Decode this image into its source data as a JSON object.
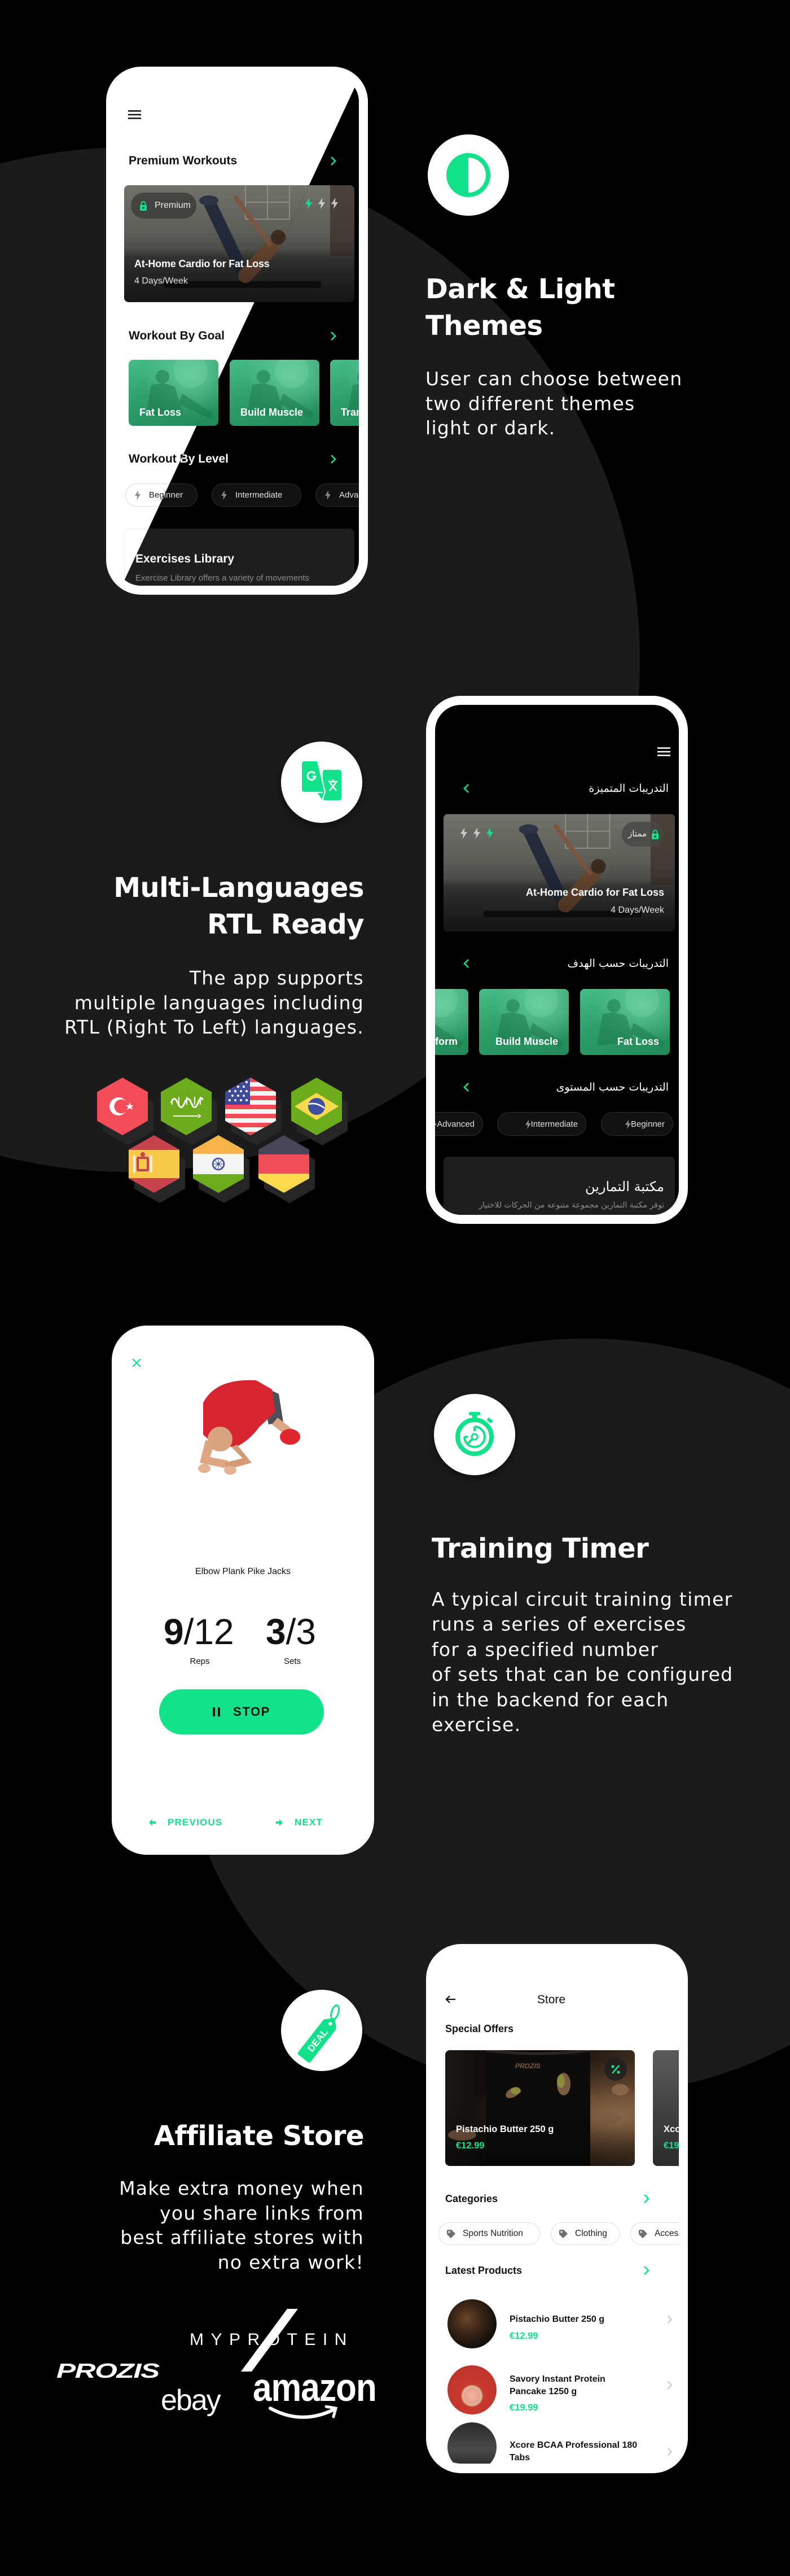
{
  "colors": {
    "accent": "#12e18b",
    "background": "#000000",
    "shape": "#1b1b1b"
  },
  "features": {
    "themes": {
      "icon": "theme-contrast-icon",
      "title_lines": [
        "Dark & Light",
        "Themes"
      ],
      "body_lines": [
        "User can choose between",
        "two different themes",
        "light or dark."
      ]
    },
    "languages": {
      "icon": "translate-icon",
      "title_lines": [
        "Multi-Languages",
        "RTL Ready"
      ],
      "body_lines": [
        "The app supports",
        "multiple languages including",
        "RTL (Right To Left) languages."
      ],
      "flag_icons": [
        "turkey-flag-icon",
        "saudi-arabia-flag-icon",
        "usa-flag-icon",
        "brazil-flag-icon",
        "spain-flag-icon",
        "india-flag-icon",
        "germany-flag-icon"
      ]
    },
    "timer": {
      "icon": "stopwatch-icon",
      "title_lines": [
        "Training Timer"
      ],
      "body_lines": [
        "A typical circuit training timer",
        "runs a series of exercises",
        "for a specified number",
        "of sets that can be configured",
        "in the backend for each",
        "exercise."
      ]
    },
    "store": {
      "icon": "deal-tag-icon",
      "icon_label": "DEAL",
      "title_lines": [
        "Affiliate Store"
      ],
      "body_lines": [
        "Make extra money when",
        "you share links from",
        "best affiliate stores with",
        "no extra work!"
      ],
      "brands": [
        "MYPROTEIN",
        "PROZIS",
        "ebay",
        "amazon"
      ]
    }
  },
  "home_screen": {
    "premium_title": "Premium Workouts",
    "premium_card": {
      "badge": "Premium",
      "title": "At-Home Cardio for Fat Loss",
      "subtitle": "4 Days/Week",
      "intensity": {
        "active": 1,
        "total": 3
      }
    },
    "goal_title": "Workout By Goal",
    "goals": [
      "Fat Loss",
      "Build Muscle",
      "Transform"
    ],
    "level_title": "Workout By Level",
    "levels": [
      "Beginner",
      "Intermediate",
      "Advanced"
    ],
    "library": {
      "title": "Exercises Library",
      "description": "Exercise Library offers a variety of movements"
    }
  },
  "rtl_screen": {
    "premium_title": "التدريبات المتميزة",
    "premium_card": {
      "badge": "ممتاز",
      "title": "At-Home Cardio for Fat Loss",
      "subtitle": "4 Days/Week",
      "intensity": {
        "active": 1,
        "total": 3
      }
    },
    "goal_title": "التدريبات حسب الهدف",
    "goals": [
      "Fat Loss",
      "Build Muscle",
      "Transform"
    ],
    "level_title": "التدريبات حسب المستوى",
    "levels": [
      "Beginner",
      "Intermediate",
      "Advanced"
    ],
    "library": {
      "title": "مكتبة التمارين",
      "description": "توفر مكتبة التمارين مجموعة متنوعة من الحركات للاختيار"
    }
  },
  "timer_screen": {
    "exercise_name": "Elbow Plank Pike Jacks",
    "separator": "/",
    "reps": {
      "current": "9",
      "total": "12",
      "label": "Reps"
    },
    "sets": {
      "current": "3",
      "total": "3",
      "label": "Sets"
    },
    "stop_label": "STOP",
    "previous_label": "PREVIOUS",
    "next_label": "NEXT"
  },
  "store_screen": {
    "title": "Store",
    "special_offers_title": "Special Offers",
    "offers": [
      {
        "name": "Pistachio Butter 250 g",
        "price": "€12.99"
      },
      {
        "name": "Xco",
        "price": "€19"
      }
    ],
    "categories_title": "Categories",
    "categories": [
      "Sports Nutrition",
      "Clothing",
      "Accessories"
    ],
    "latest_title": "Latest Products",
    "products": [
      {
        "name": "Pistachio Butter 250 g",
        "price": "€12.99"
      },
      {
        "name": "Savory Instant Protein Pancake 1250 g",
        "price": "€19.99"
      },
      {
        "name": "Xcore BCAA Professional 180 Tabs"
      }
    ]
  }
}
